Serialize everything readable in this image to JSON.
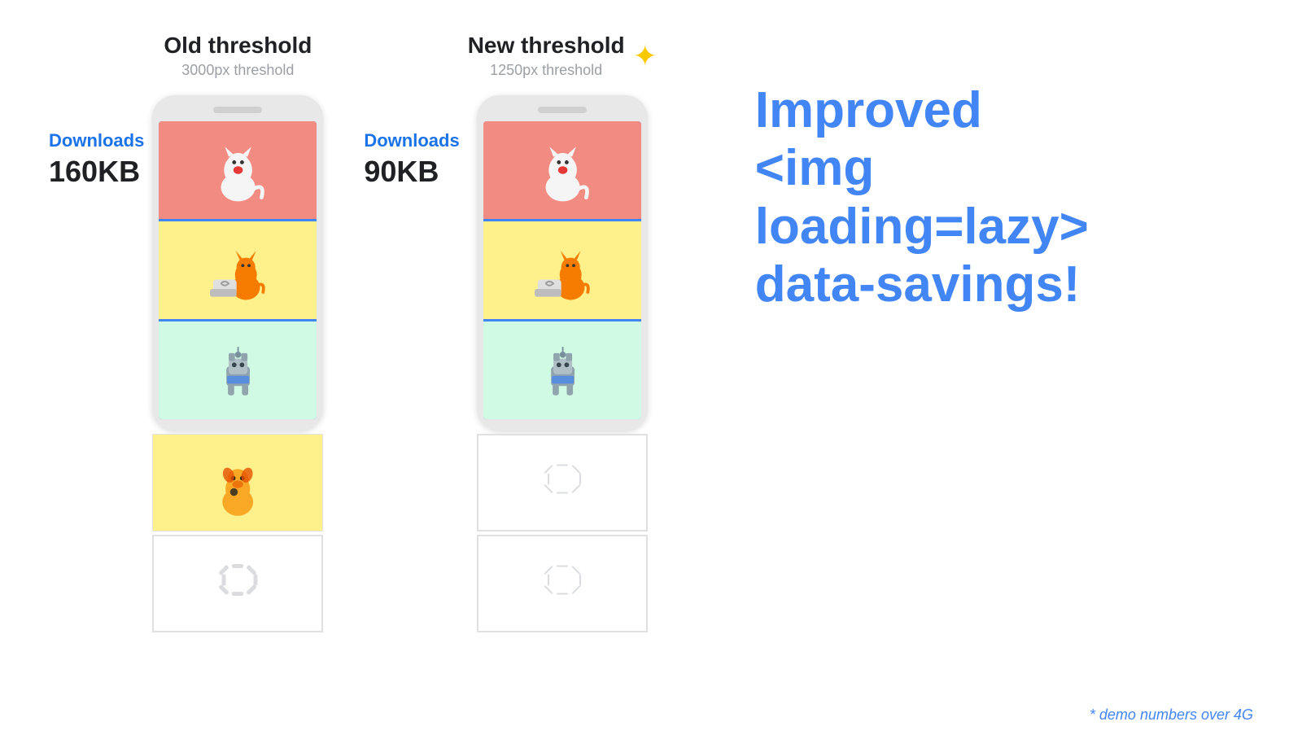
{
  "left_column": {
    "title": "Old threshold",
    "subtitle": "3000px threshold",
    "downloads_label": "Downloads",
    "downloads_size": "160KB"
  },
  "right_column": {
    "title": "New threshold",
    "subtitle": "1250px threshold",
    "downloads_label": "Downloads",
    "downloads_size": "90KB",
    "sparkle": "✦"
  },
  "info": {
    "line1": "Improved",
    "line2": "<img loading=lazy>",
    "line3": "data-savings!"
  },
  "footer": {
    "note": "* demo numbers over 4G"
  }
}
